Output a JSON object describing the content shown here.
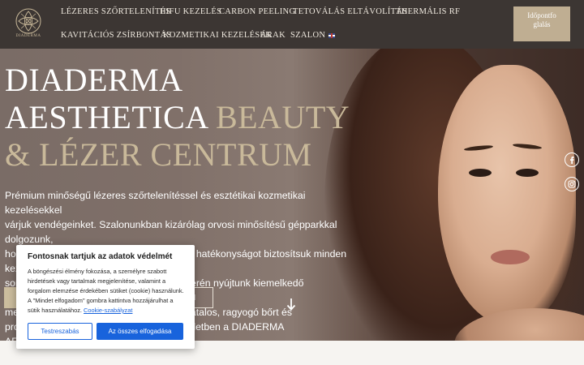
{
  "header": {
    "logo_text": "DIADERMA",
    "nav": [
      {
        "label": "LÉZERES SZŐRTELENÍTÉS"
      },
      {
        "label": "HIFU KEZELÉS"
      },
      {
        "label": "CARBON PEELING"
      },
      {
        "label": "TETOVÁLÁS ELTÁVOLÍTÁS"
      },
      {
        "label": "THERMÁLIS RF"
      },
      {
        "label": "KAVITÁCIÓS ZSÍRBONTÁS"
      },
      {
        "label": "KOZMETIKAI KEZELÉSEK"
      },
      {
        "label": "ÁRAK"
      },
      {
        "label": "SZALON"
      }
    ],
    "booking_label": "Időpontfoglalás"
  },
  "hero": {
    "title_white": "DIADERMA AESTHETICA",
    "title_gold": "BEAUTY & LÉZER CENTRUM",
    "text_lines": [
      "Prémium minőségű lézeres szőrtelenítéssel és esztétikai kozmetikai kezelésekkel",
      "várjuk vendégeinket. Szalonunkban kizárólag orvosi minősítésű gépparkkal dolgozunk,",
      "hogy a legmagasabb szintű biztonságot és hatékonyságot biztosítsuk minden kezelés",
      "során. Különösen a lézeres szőrtelenítés terén nyújtunk kiemelkedő szolgáltatásokat,",
      "me                                              lnak. Ha fiatalos, ragyogó bőrt és",
      "pro                                              l, a 9. kerületben a DIADERMA",
      "AE"
    ],
    "button_right_label": "N"
  },
  "cookie": {
    "title": "Fontosnak tartjuk az adatok védelmét",
    "text": "A böngészési élmény fokozása, a személyre szabott hirdetések vagy tartalmak megjelenítése, valamint a forgalom elemzése érdekében sütiket (cookie) használunk. A \"Mindet elfogadom\" gombra kattintva hozzájárulhat a sütik használatához.",
    "link_text": "Cookie-szabályzat",
    "customize_label": "Testreszabás",
    "accept_label": "Az összes elfogadása",
    "primary_color": "#1863dc"
  },
  "colors": {
    "header_bg": "#3c3633",
    "accent_gold": "#bfae92"
  },
  "icons": [
    "logo-emblem",
    "uk-flag-icon",
    "arrow-down-icon",
    "facebook-icon",
    "instagram-icon"
  ]
}
